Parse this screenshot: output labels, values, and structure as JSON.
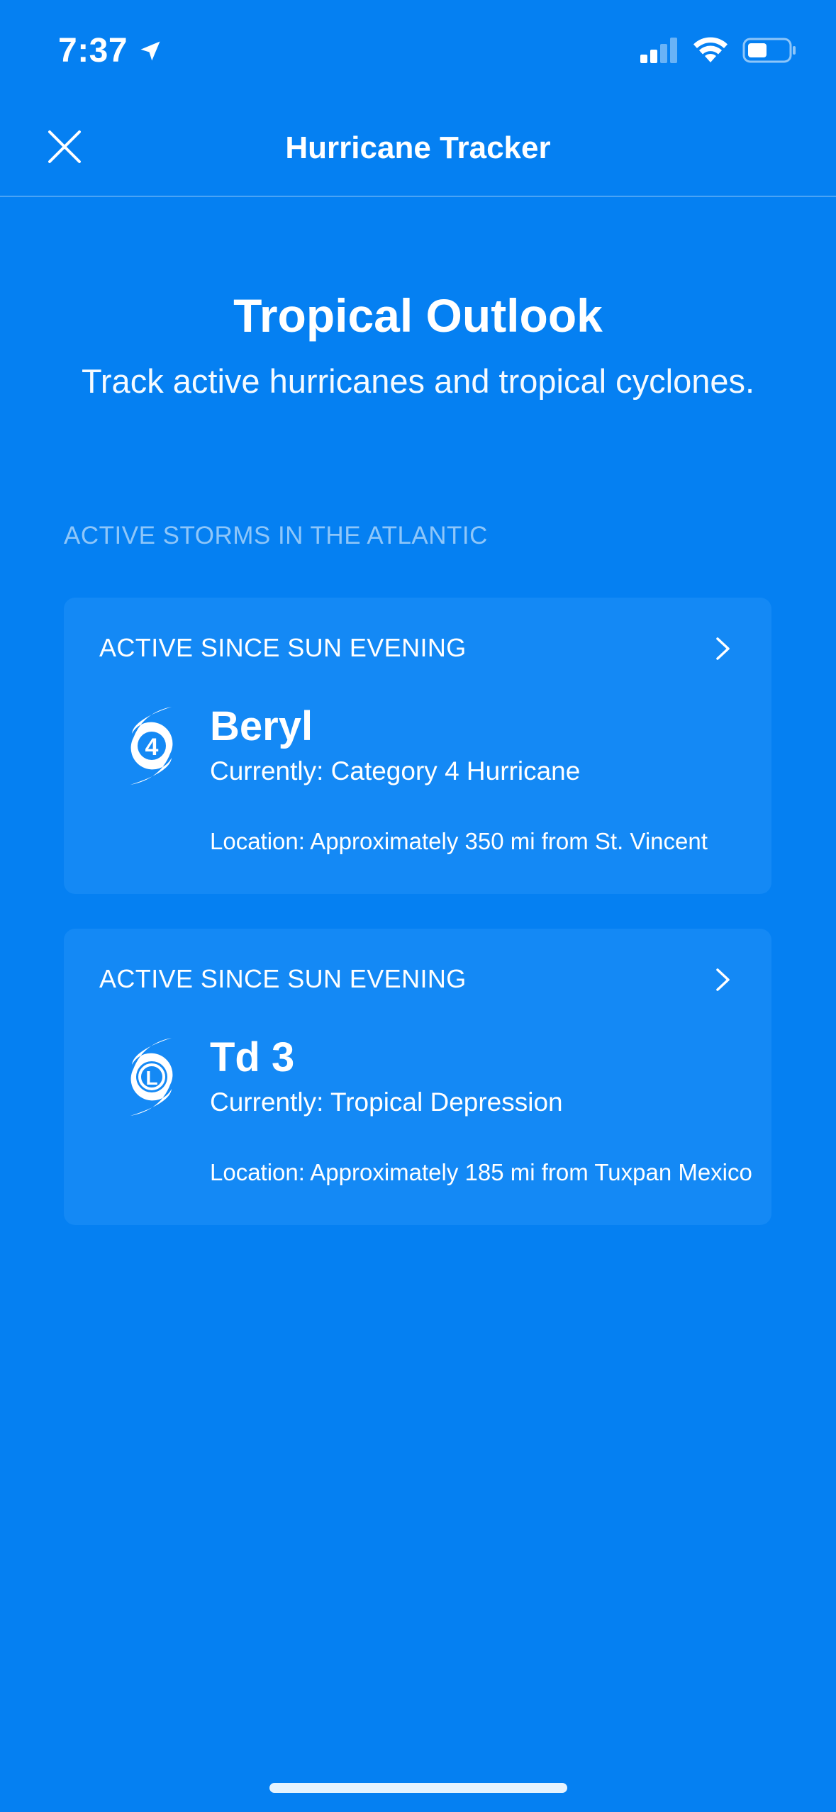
{
  "status_bar": {
    "time": "7:37",
    "icons": [
      "location-arrow-icon",
      "cellular-signal-icon",
      "wifi-icon",
      "battery-icon"
    ]
  },
  "nav": {
    "title": "Hurricane Tracker",
    "close_icon": "close-icon"
  },
  "hero": {
    "title": "Tropical Outlook",
    "subtitle": "Track active hurricanes and tropical cyclones."
  },
  "section": {
    "header": "ACTIVE STORMS IN THE ATLANTIC"
  },
  "storms": [
    {
      "since": "ACTIVE SINCE SUN EVENING",
      "icon_label": "4",
      "icon": "hurricane-category-icon",
      "name": "Beryl",
      "current": "Currently: Category 4 Hurricane",
      "location": "Location: Approximately 350 mi from St. Vincent"
    },
    {
      "since": "ACTIVE SINCE SUN EVENING",
      "icon_label": "L",
      "icon": "tropical-depression-icon",
      "name": "Td 3",
      "current": "Currently: Tropical Depression",
      "location": "Location: Approximately 185 mi from Tuxpan Mexico"
    }
  ],
  "colors": {
    "background": "#0580F2",
    "card": "#1489F5",
    "text": "#FFFFFF"
  }
}
